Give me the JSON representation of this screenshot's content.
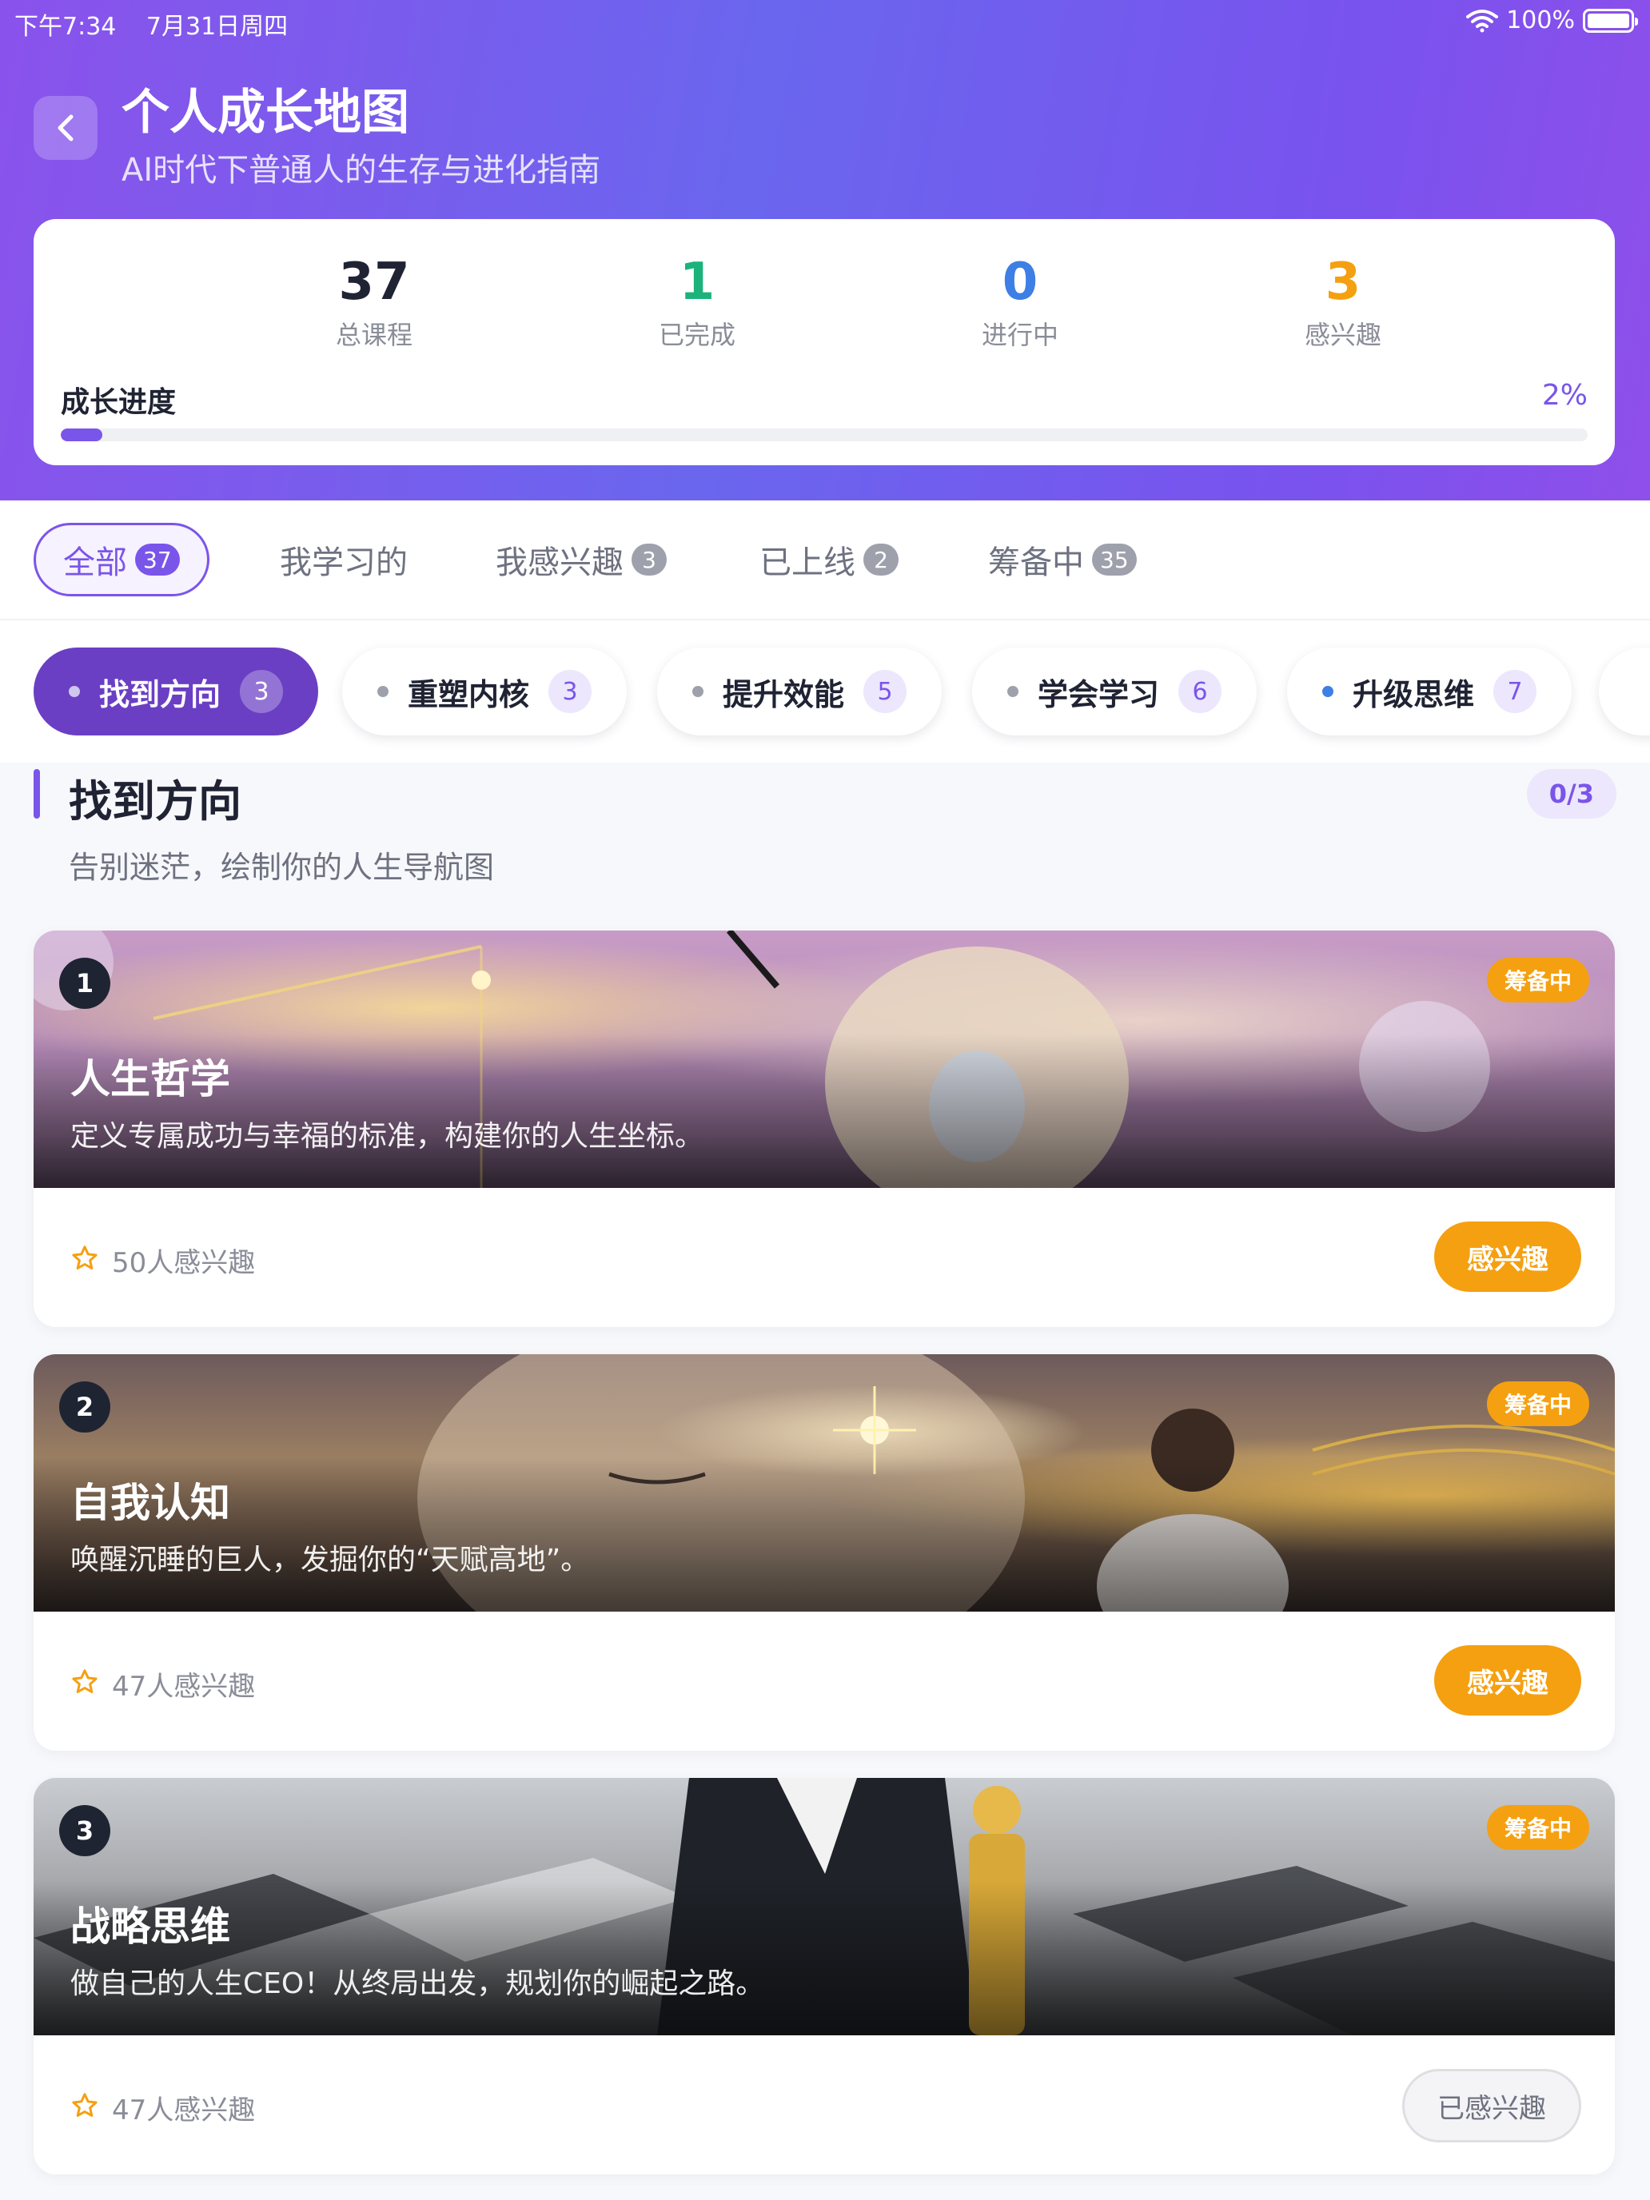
{
  "status_bar": {
    "time": "下午7:34",
    "date": "7月31日周四",
    "battery": "100%"
  },
  "header": {
    "title": "个人成长地图",
    "subtitle": "AI时代下普通人的生存与进化指南"
  },
  "stats": [
    {
      "value": "37",
      "label": "总课程",
      "color": "#1f2333"
    },
    {
      "value": "1",
      "label": "已完成",
      "color": "#1bb37b"
    },
    {
      "value": "0",
      "label": "进行中",
      "color": "#3d7fe5"
    },
    {
      "value": "3",
      "label": "感兴趣",
      "color": "#f5a011"
    }
  ],
  "progress": {
    "label": "成长进度",
    "percent_text": "2%",
    "value": 0.027
  },
  "tabs": [
    {
      "label": "全部",
      "count": "37",
      "active": true
    },
    {
      "label": "我学习的",
      "count": "",
      "active": false
    },
    {
      "label": "我感兴趣",
      "count": "3",
      "active": false
    },
    {
      "label": "已上线",
      "count": "2",
      "active": false
    },
    {
      "label": "筹备中",
      "count": "35",
      "active": false
    }
  ],
  "categories": [
    {
      "label": "找到方向",
      "count": "3",
      "active": true
    },
    {
      "label": "重塑内核",
      "count": "3",
      "active": false
    },
    {
      "label": "提升效能",
      "count": "5",
      "active": false
    },
    {
      "label": "学会学习",
      "count": "6",
      "active": false
    },
    {
      "label": "升级思维",
      "count": "7",
      "active": false
    }
  ],
  "section": {
    "title": "找到方向",
    "description": "告别迷茫，绘制你的人生导航图",
    "progress": "0/3"
  },
  "courses": [
    {
      "index": "1",
      "status": "筹备中",
      "title": "人生哲学",
      "description": "定义专属成功与幸福的标准，构建你的人生坐标。",
      "interest_count": "50人感兴趣",
      "action": "感兴趣",
      "interested": false
    },
    {
      "index": "2",
      "status": "筹备中",
      "title": "自我认知",
      "description": "唤醒沉睡的巨人，发掘你的“天赋高地”。",
      "interest_count": "47人感兴趣",
      "action": "感兴趣",
      "interested": false
    },
    {
      "index": "3",
      "status": "筹备中",
      "title": "战略思维",
      "description": "做自己的人生CEO！从终局出发，规划你的崛起之路。",
      "interest_count": "47人感兴趣",
      "action": "已感兴趣",
      "interested": true
    }
  ],
  "colors": {
    "accent": "#7a55e9",
    "orange": "#f5a011",
    "chip_active": "#6a3fc4"
  }
}
